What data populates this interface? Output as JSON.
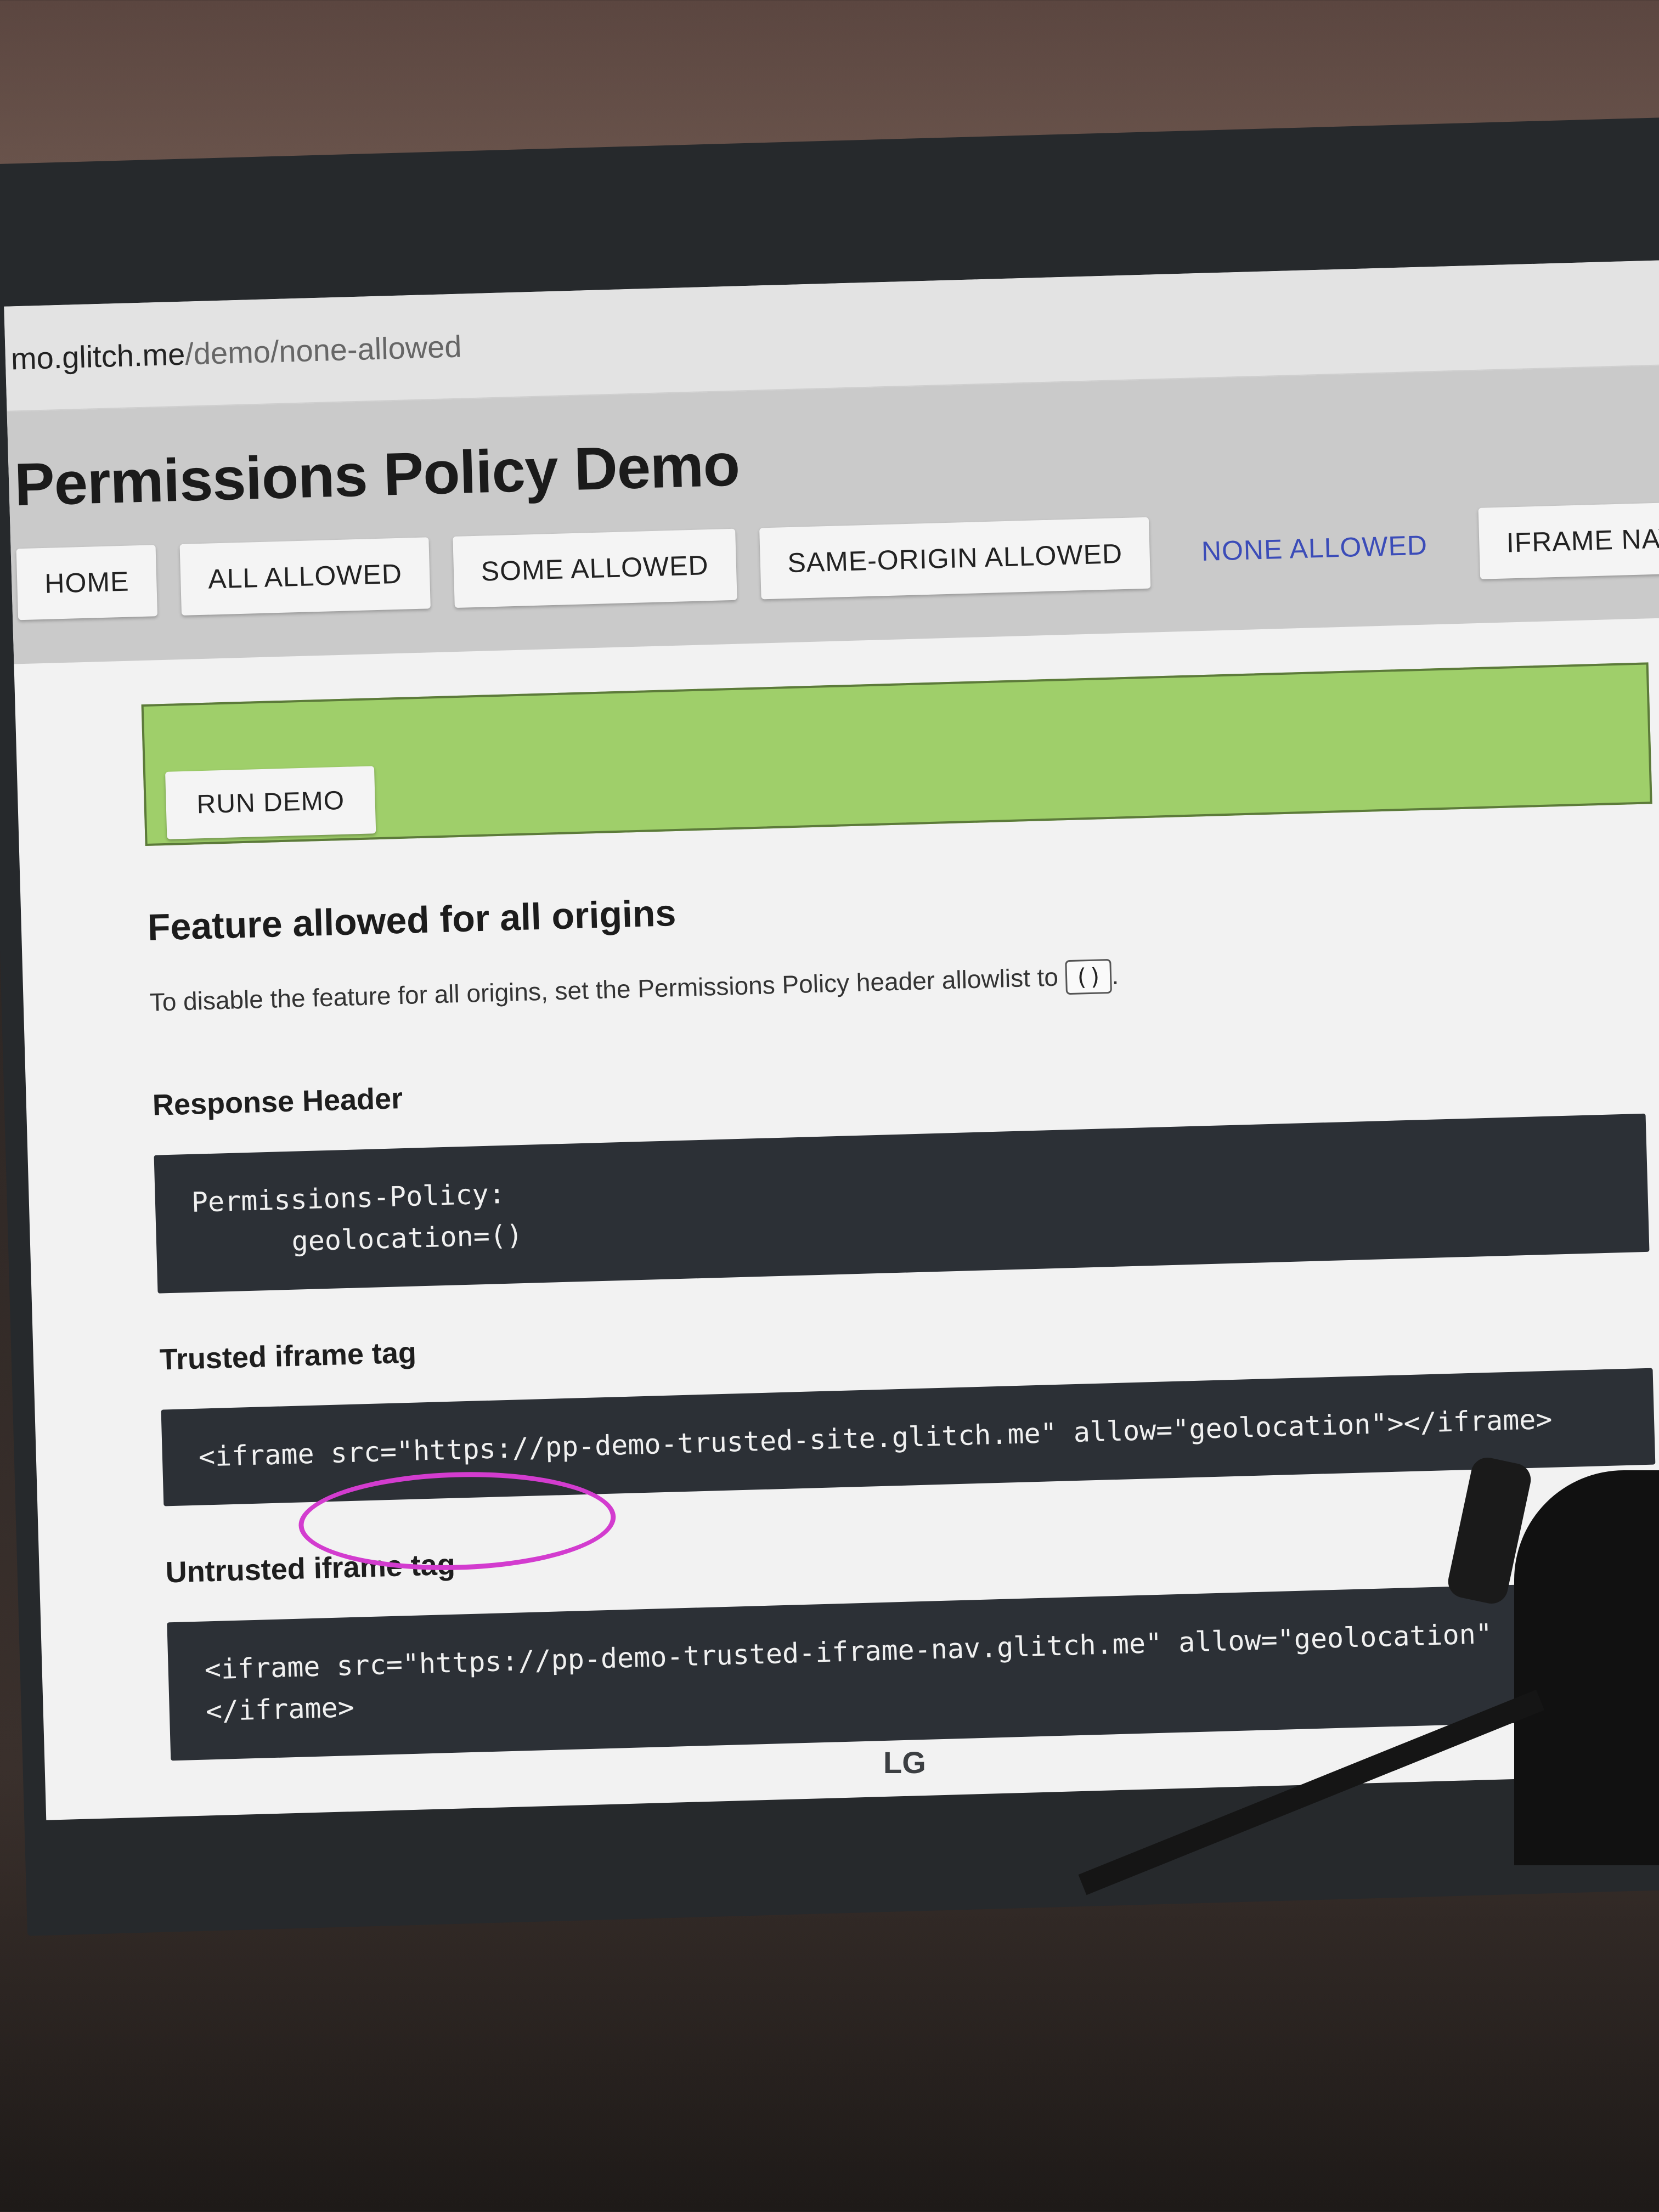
{
  "browser": {
    "url_host": "mo.glitch.me",
    "url_path": "/demo/none-allowed"
  },
  "header": {
    "title": "Permissions Policy Demo"
  },
  "nav": [
    {
      "label": "HOME"
    },
    {
      "label": "ALL ALLOWED"
    },
    {
      "label": "SOME ALLOWED"
    },
    {
      "label": "SAME-ORIGIN ALLOWED"
    },
    {
      "label": "NONE ALLOWED",
      "active": true
    },
    {
      "label": "IFRAME NAVIGATION AL"
    }
  ],
  "demo": {
    "run_label": "RUN DEMO",
    "box_color": "#9fcf6a"
  },
  "section": {
    "heading": "Feature allowed for all origins",
    "description": "To disable the feature for all origins, set the Permissions Policy header allowlist to",
    "allowlist_value": "()"
  },
  "response_header": {
    "label": "Response Header",
    "code": "Permissions-Policy:\n      geolocation=()"
  },
  "trusted": {
    "label": "Trusted iframe tag",
    "code": "<iframe src=\"https://pp-demo-trusted-site.glitch.me\" allow=\"geolocation\"></iframe>"
  },
  "untrusted": {
    "label": "Untrusted iframe tag",
    "code": "<iframe src=\"https://pp-demo-trusted-iframe-nav.glitch.me\" allow=\"geolocation\"\n</iframe>"
  },
  "monitor": {
    "brand": "LG"
  },
  "colors": {
    "active_nav": "#3b4cb8",
    "code_bg": "#2c3036",
    "annotation": "#d33ccf"
  }
}
